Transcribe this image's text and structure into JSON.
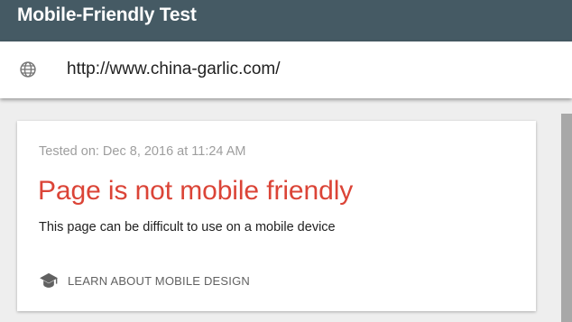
{
  "header": {
    "title": "Mobile-Friendly Test"
  },
  "url_bar": {
    "icon": "globe-icon",
    "value": "http://www.china-garlic.com/"
  },
  "result": {
    "tested_on": "Tested on: Dec 8, 2016 at 11:24 AM",
    "verdict": "Page is not mobile friendly",
    "description": "This page can be difficult to use on a mobile device",
    "learn_link": {
      "icon": "school-icon",
      "label": "LEARN ABOUT MOBILE DESIGN"
    }
  },
  "colors": {
    "header_bg": "#455a64",
    "verdict_red": "#db4437",
    "page_bg": "#eeeeee"
  }
}
